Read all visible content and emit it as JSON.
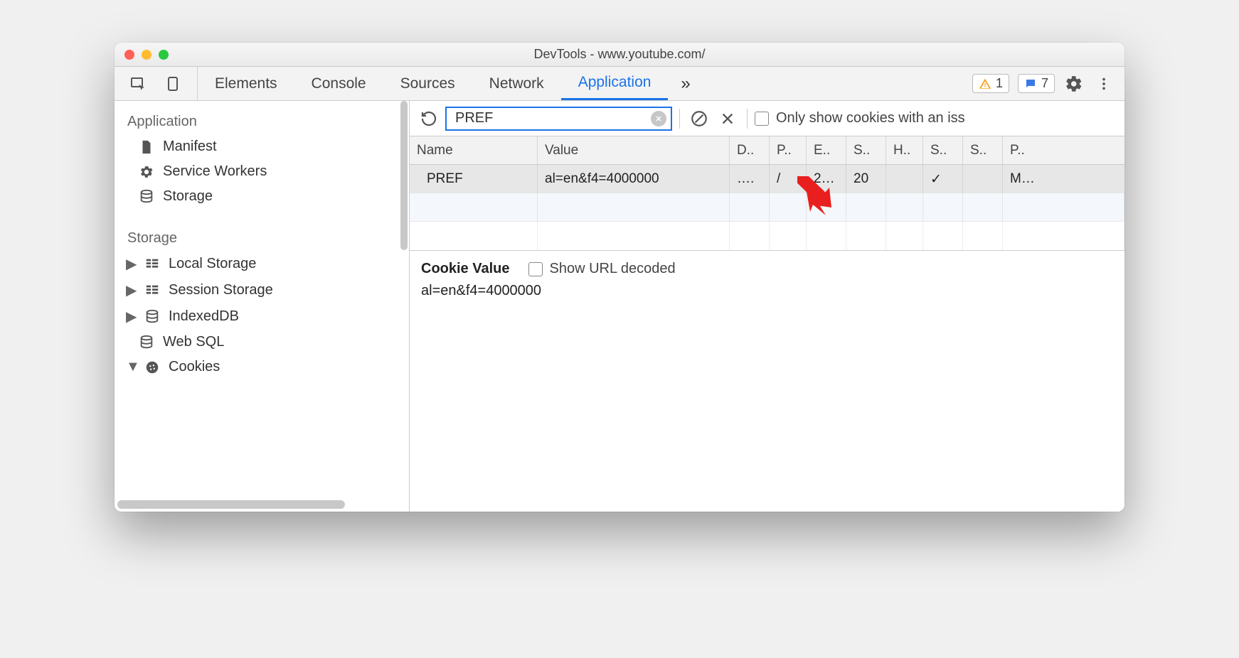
{
  "window": {
    "title": "DevTools - www.youtube.com/"
  },
  "tabs": {
    "items": [
      "Elements",
      "Console",
      "Sources",
      "Network",
      "Application"
    ],
    "active": "Application"
  },
  "badges": {
    "warn_count": "1",
    "msg_count": "7"
  },
  "sidebar": {
    "section_app": "Application",
    "app_items": [
      "Manifest",
      "Service Workers",
      "Storage"
    ],
    "section_storage": "Storage",
    "storage_items": [
      "Local Storage",
      "Session Storage",
      "IndexedDB",
      "Web SQL",
      "Cookies"
    ]
  },
  "toolbar": {
    "filter_value": "PREF",
    "only_issue_label": "Only show cookies with an iss"
  },
  "table": {
    "headers": [
      "Name",
      "Value",
      "D..",
      "P..",
      "E..",
      "S..",
      "H..",
      "S..",
      "S..",
      "P.."
    ],
    "row": {
      "name": "PREF",
      "value": "al=en&f4=4000000",
      "d": "….",
      "p": "/",
      "e": "2…",
      "s": "20",
      "h": "",
      "se": "✓",
      "sa": "",
      "pr": "M…"
    }
  },
  "detail": {
    "heading": "Cookie Value",
    "decode_label": "Show URL decoded",
    "value": "al=en&f4=4000000"
  }
}
